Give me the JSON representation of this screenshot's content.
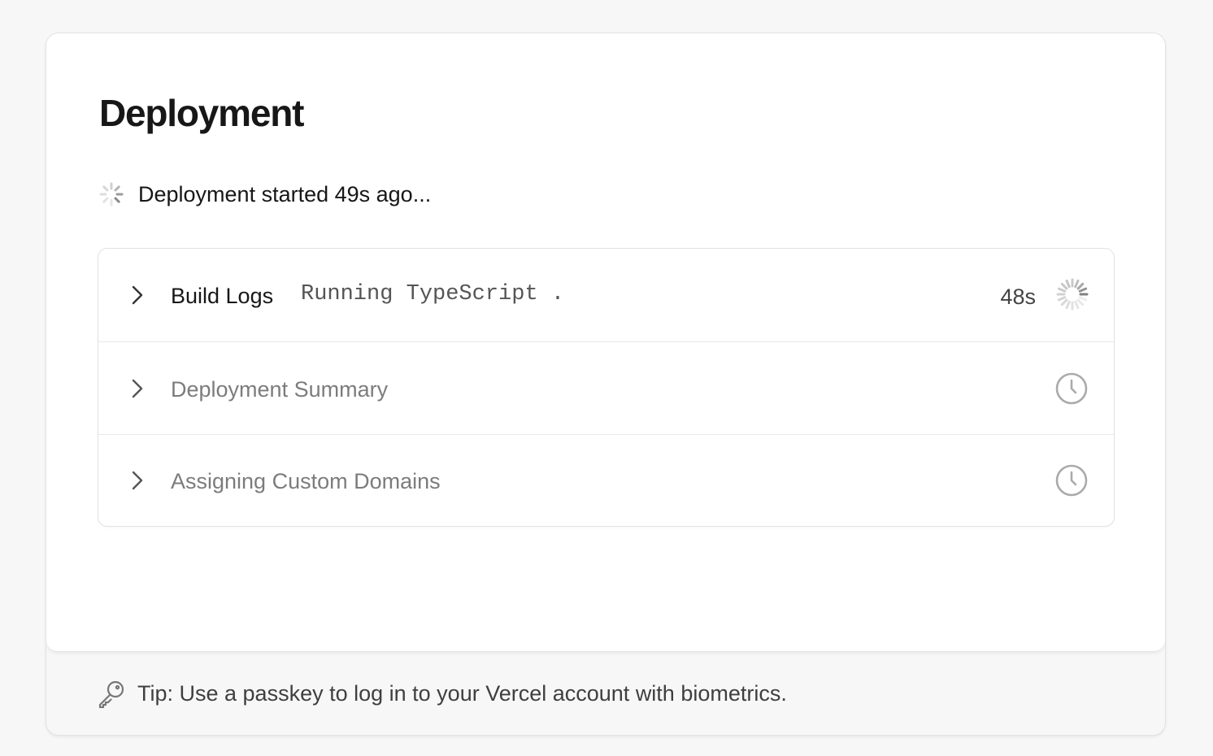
{
  "deployment": {
    "title": "Deployment",
    "status_text": "Deployment started 49s ago...",
    "status_icon": "loading-spinner-icon"
  },
  "steps": [
    {
      "label": "Build Logs",
      "log_text": "Running TypeScript .",
      "duration": "48s",
      "state": "running",
      "status_icon": "loading-spinner-icon"
    },
    {
      "label": "Deployment Summary",
      "state": "pending",
      "status_icon": "clock-icon"
    },
    {
      "label": "Assigning Custom Domains",
      "state": "pending",
      "status_icon": "clock-icon"
    }
  ],
  "footer": {
    "tip_text": "Tip: Use a passkey to log in to your Vercel account with biometrics.",
    "icon": "key-icon"
  },
  "colors": {
    "text_primary": "#171717",
    "text_muted": "#7c7c7c",
    "border": "#e3e3e3",
    "background": "#f7f7f7"
  }
}
